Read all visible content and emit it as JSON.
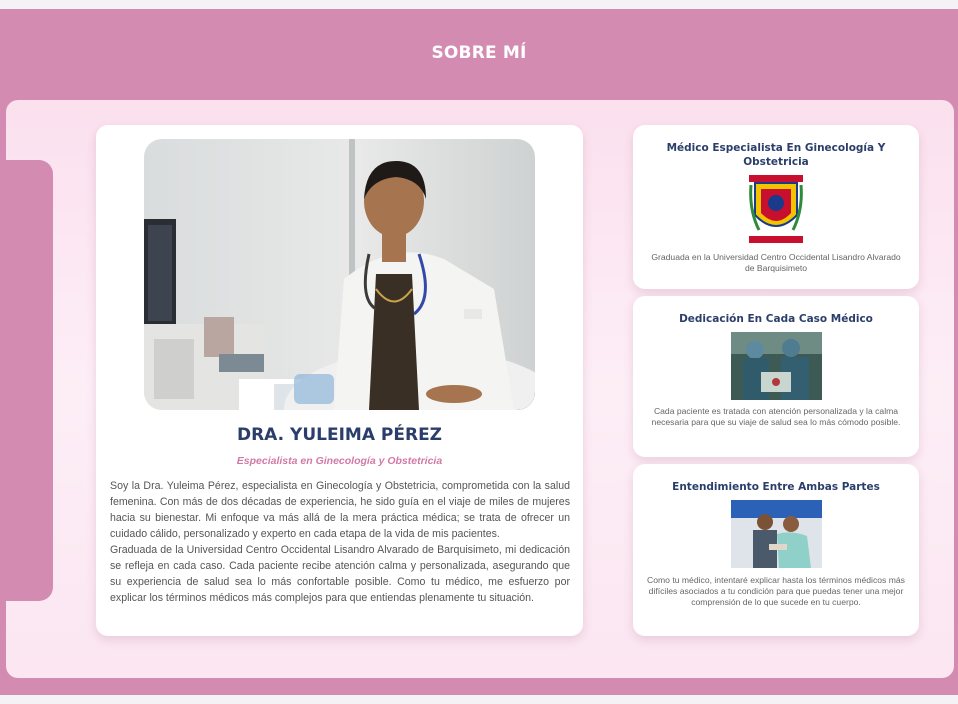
{
  "section": {
    "title": "SOBRE MÍ"
  },
  "profile": {
    "photo_icon": "doctor-portrait-photo",
    "name": "DRA. YULEIMA PÉREZ",
    "specialty": "Especialista en Ginecología y Obstetricia",
    "bio": [
      "Soy la Dra. Yuleima Pérez, especialista en Ginecología y Obstetricia, comprometida con la salud femenina. Con más de dos décadas de experiencia, he sido guía en el viaje de miles de mujeres hacia su bienestar. Mi enfoque va más allá de la mera práctica médica; se trata de ofrecer un cuidado cálido, personalizado y experto en cada etapa de la vida de mis pacientes.",
      "Graduada de la Universidad Centro Occidental Lisandro Alvarado de Barquisimeto, mi dedicación se refleja en cada caso. Cada paciente recibe atención calma y personalizada, asegurando que su experiencia de salud sea lo más confortable posible. Como tu médico, me esfuerzo por explicar los términos médicos más complejos para que entiendas plenamente tu situación."
    ]
  },
  "cards": [
    {
      "title": "Médico Especialista En Ginecología Y Obstetricia",
      "image": "university-crest-icon",
      "description": "Graduada en la Universidad Centro Occidental Lisandro Alvarado de Barquisimeto"
    },
    {
      "title": "Dedicación En Cada Caso Médico",
      "image": "surgery-team-photo",
      "description": "Cada paciente es tratada con atención personalizada y la calma necesaria para que su viaje de salud sea lo más cómodo posible."
    },
    {
      "title": "Entendimiento Entre Ambas Partes",
      "image": "doctor-patient-photo",
      "description": "Como tu médico, intentaré explicar hasta los términos médicos más difíciles asociados a tu condición para que puedas tener una mejor comprensión de lo que sucede en tu cuerpo."
    }
  ]
}
